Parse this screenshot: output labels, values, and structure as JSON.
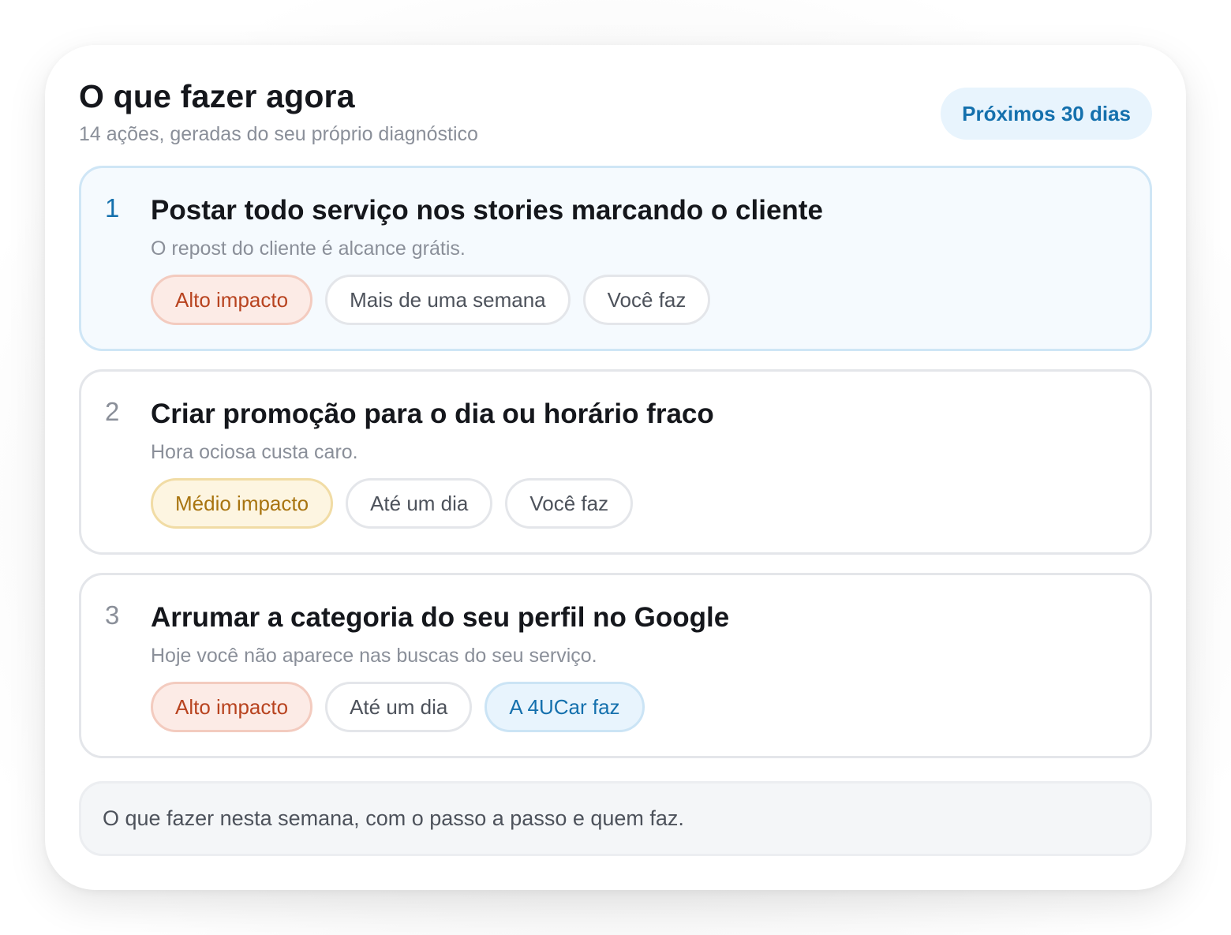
{
  "header": {
    "title": "O que fazer agora",
    "subtitle": "14 ações, geradas do seu próprio diagnóstico",
    "period_label": "Próximos 30 dias"
  },
  "actions": [
    {
      "number": "1",
      "title": "Postar todo serviço nos stories marcando o cliente",
      "description": "O repost do cliente é alcance grátis.",
      "tags": [
        "Alto impacto",
        "Mais de uma semana",
        "Você faz"
      ]
    },
    {
      "number": "2",
      "title": "Criar promoção para o dia ou horário fraco",
      "description": "Hora ociosa custa caro.",
      "tags": [
        "Médio impacto",
        "Até um dia",
        "Você faz"
      ]
    },
    {
      "number": "3",
      "title": "Arrumar a categoria do seu perfil no Google",
      "description": "Hoje você não aparece nas buscas do seu serviço.",
      "tags": [
        "Alto impacto",
        "Até um dia",
        "A 4UCar faz"
      ]
    }
  ],
  "footer": {
    "text": "O que fazer nesta semana, com o passo a passo e quem faz."
  },
  "colors": {
    "accent": "#1470ad",
    "high_impact": "#b8431f",
    "medium_impact": "#a8740f",
    "active_card_bg": "#f5fafe"
  }
}
